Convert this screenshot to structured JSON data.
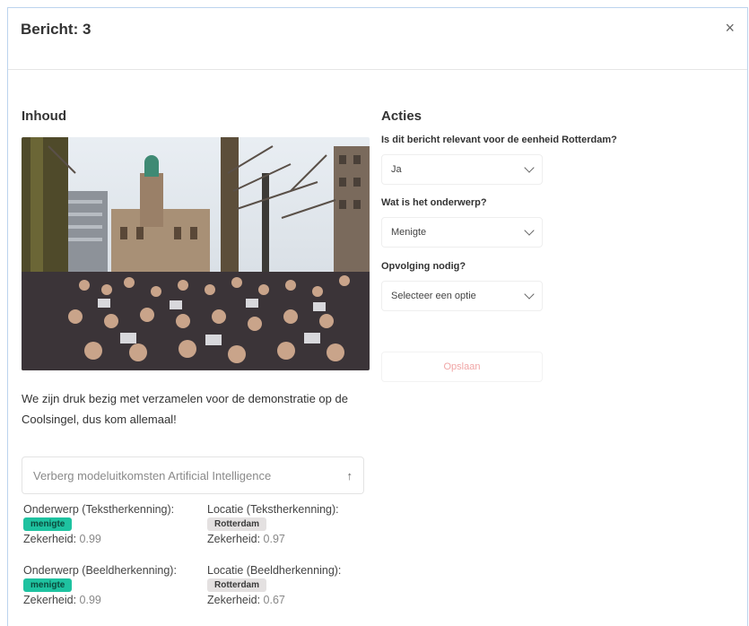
{
  "modal": {
    "title": "Bericht: 3",
    "close_glyph": "×"
  },
  "content": {
    "heading": "Inhoud",
    "post_text": "We zijn druk bezig met verzamelen voor de demonstratie op de Coolsingel, dus kom allemaal!",
    "ai_toggle": {
      "label": "Verberg modeluitkomsten Artificial Intelligence",
      "icon": "arrow-up-icon",
      "glyph": "↑"
    },
    "ai_results": [
      {
        "label": "Onderwerp (Tekstherkenning):",
        "tag": "menigte",
        "tag_color": "#1ec2a0",
        "confidence_label": "Zekerheid:",
        "confidence": "0.99"
      },
      {
        "label": "Locatie (Tekstherkenning):",
        "tag": "Rotterdam",
        "tag_color": "#e4e1e1",
        "confidence_label": "Zekerheid:",
        "confidence": "0.97"
      },
      {
        "label": "Onderwerp (Beeldherkenning):",
        "tag": "menigte",
        "tag_color": "#1ec2a0",
        "confidence_label": "Zekerheid:",
        "confidence": "0.99"
      },
      {
        "label": "Locatie (Beeldherkenning):",
        "tag": "Rotterdam",
        "tag_color": "#e4e1e1",
        "confidence_label": "Zekerheid:",
        "confidence": "0.67"
      }
    ]
  },
  "actions": {
    "heading": "Acties",
    "questions": [
      {
        "label": "Is dit bericht relevant voor de eenheid Rotterdam?",
        "value": "Ja"
      },
      {
        "label": "Wat is het onderwerp?",
        "value": "Menigte"
      },
      {
        "label": "Opvolging nodig?",
        "value": "Selecteer een optie"
      }
    ],
    "save_label": "Opslaan",
    "save_color": "#f0a5a5"
  }
}
